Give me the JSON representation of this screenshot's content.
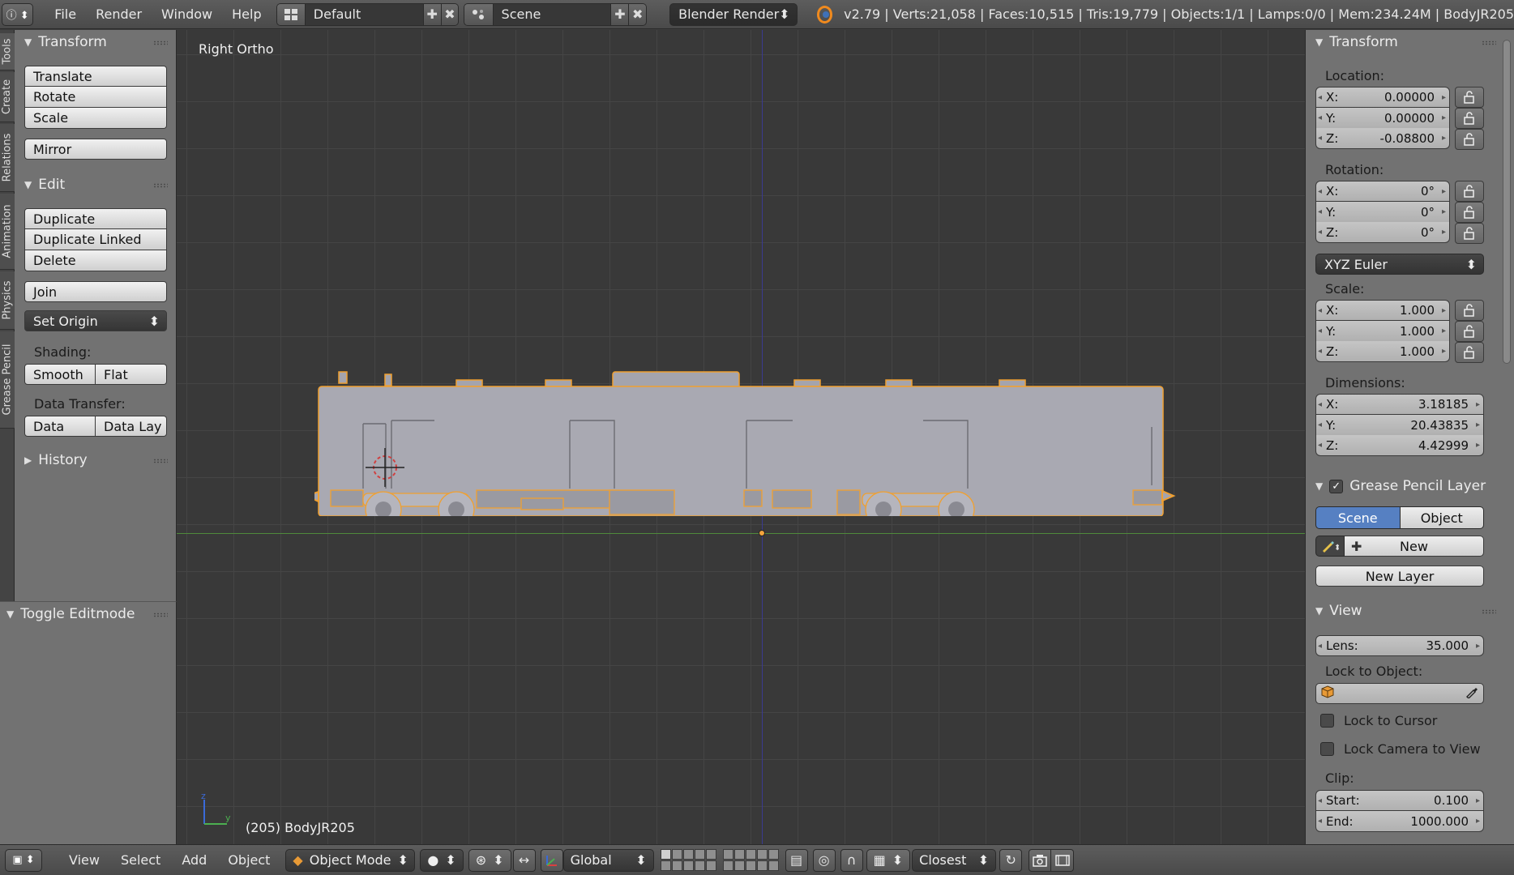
{
  "header": {
    "menus": [
      "File",
      "Render",
      "Window",
      "Help"
    ],
    "screen_layout": "Default",
    "scene": "Scene",
    "render_engine": "Blender Render",
    "stats": "v2.79 | Verts:21,058 | Faces:10,515 | Tris:19,779 | Objects:1/1 | Lamps:0/0 | Mem:234.24M | BodyJR205"
  },
  "tabs": [
    "Tools",
    "Create",
    "Relations",
    "Animation",
    "Physics",
    "Grease Pencil"
  ],
  "tool_shelf": {
    "transform": {
      "title": "Transform",
      "buttons": [
        "Translate",
        "Rotate",
        "Scale",
        "Mirror"
      ]
    },
    "edit": {
      "title": "Edit",
      "buttons": [
        "Duplicate",
        "Duplicate Linked",
        "Delete",
        "Join"
      ],
      "set_origin": "Set Origin"
    },
    "shading": {
      "label": "Shading:",
      "smooth": "Smooth",
      "flat": "Flat"
    },
    "data_transfer": {
      "label": "Data Transfer:",
      "data": "Data",
      "data_lay": "Data Lay"
    },
    "history": {
      "title": "History"
    },
    "operator": {
      "title": "Toggle Editmode"
    }
  },
  "viewport": {
    "view_name": "Right Ortho",
    "status": "(205) BodyJR205",
    "axis_z": "z",
    "axis_y": "y"
  },
  "properties": {
    "transform_title": "Transform",
    "location": {
      "label": "Location:",
      "x": "0.00000",
      "y": "0.00000",
      "z": "-0.08800"
    },
    "rotation": {
      "label": "Rotation:",
      "x": "0°",
      "y": "0°",
      "z": "0°"
    },
    "rotation_mode": "XYZ Euler",
    "scale": {
      "label": "Scale:",
      "x": "1.000",
      "y": "1.000",
      "z": "1.000"
    },
    "dimensions": {
      "label": "Dimensions:",
      "x": "3.18185",
      "y": "20.43835",
      "z": "4.42999"
    },
    "axis_x": "X:",
    "axis_y": "Y:",
    "axis_z": "Z:",
    "grease_pencil": {
      "title": "Grease Pencil Layer",
      "scene": "Scene",
      "object": "Object",
      "new": "New",
      "new_layer": "New Layer"
    },
    "view": {
      "title": "View",
      "lens_label": "Lens:",
      "lens": "35.000",
      "lock_to_object": "Lock to Object:",
      "lock_to_cursor": "Lock to Cursor",
      "lock_camera": "Lock Camera to View",
      "clip_label": "Clip:",
      "start_label": "Start:",
      "start": "0.100",
      "end_label": "End:",
      "end": "1000.000"
    }
  },
  "footer": {
    "menus": [
      "View",
      "Select",
      "Add",
      "Object"
    ],
    "mode": "Object Mode",
    "orientation": "Global",
    "snap": "Closest"
  },
  "colors": {
    "selection_outline": "#f0a030",
    "x_axis": "#4f8a3b",
    "z_axis": "#3a3a90",
    "accent_blue": "#5680c2"
  }
}
